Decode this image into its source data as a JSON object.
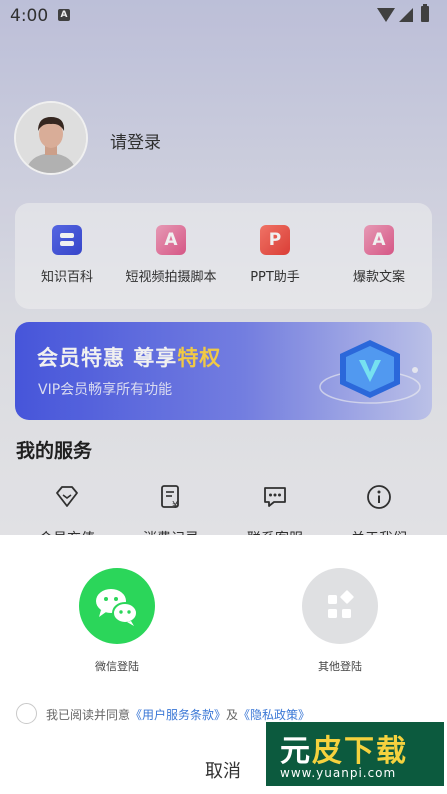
{
  "status_bar": {
    "time": "4:00",
    "notif_icon": "A"
  },
  "profile": {
    "login_label": "请登录"
  },
  "tools": [
    {
      "label": "知识百科",
      "icon": "book-icon"
    },
    {
      "label": "短视频拍摄脚本",
      "icon": "A"
    },
    {
      "label": "PPT助手",
      "icon": "P"
    },
    {
      "label": "爆款文案",
      "icon": "A"
    }
  ],
  "vip": {
    "title_main": "会员特惠 尊享",
    "title_accent": "特权",
    "subtitle": "VIP会员畅享所有功能"
  },
  "services": {
    "title": "我的服务",
    "items": [
      {
        "label": "会员充值",
        "icon": "diamond-icon"
      },
      {
        "label": "消费记录",
        "icon": "receipt-icon"
      },
      {
        "label": "联系客服",
        "icon": "chat-icon"
      },
      {
        "label": "关于我们",
        "icon": "info-icon"
      }
    ]
  },
  "login_sheet": {
    "wechat_label": "微信登陆",
    "other_label": "其他登陆",
    "agree_prefix": "我已阅读并同意",
    "terms_link": "《用户服务条款》",
    "and_text": "及",
    "privacy_link": "《隐私政策》",
    "cancel_label": "取消"
  },
  "watermark": {
    "big_a": "元",
    "big_b": "皮下载",
    "url": "www.yuanpi.com"
  },
  "colors": {
    "wechat_green": "#2bd65a",
    "vip_gold": "#ffd64a",
    "link_blue": "#3a77d6"
  }
}
